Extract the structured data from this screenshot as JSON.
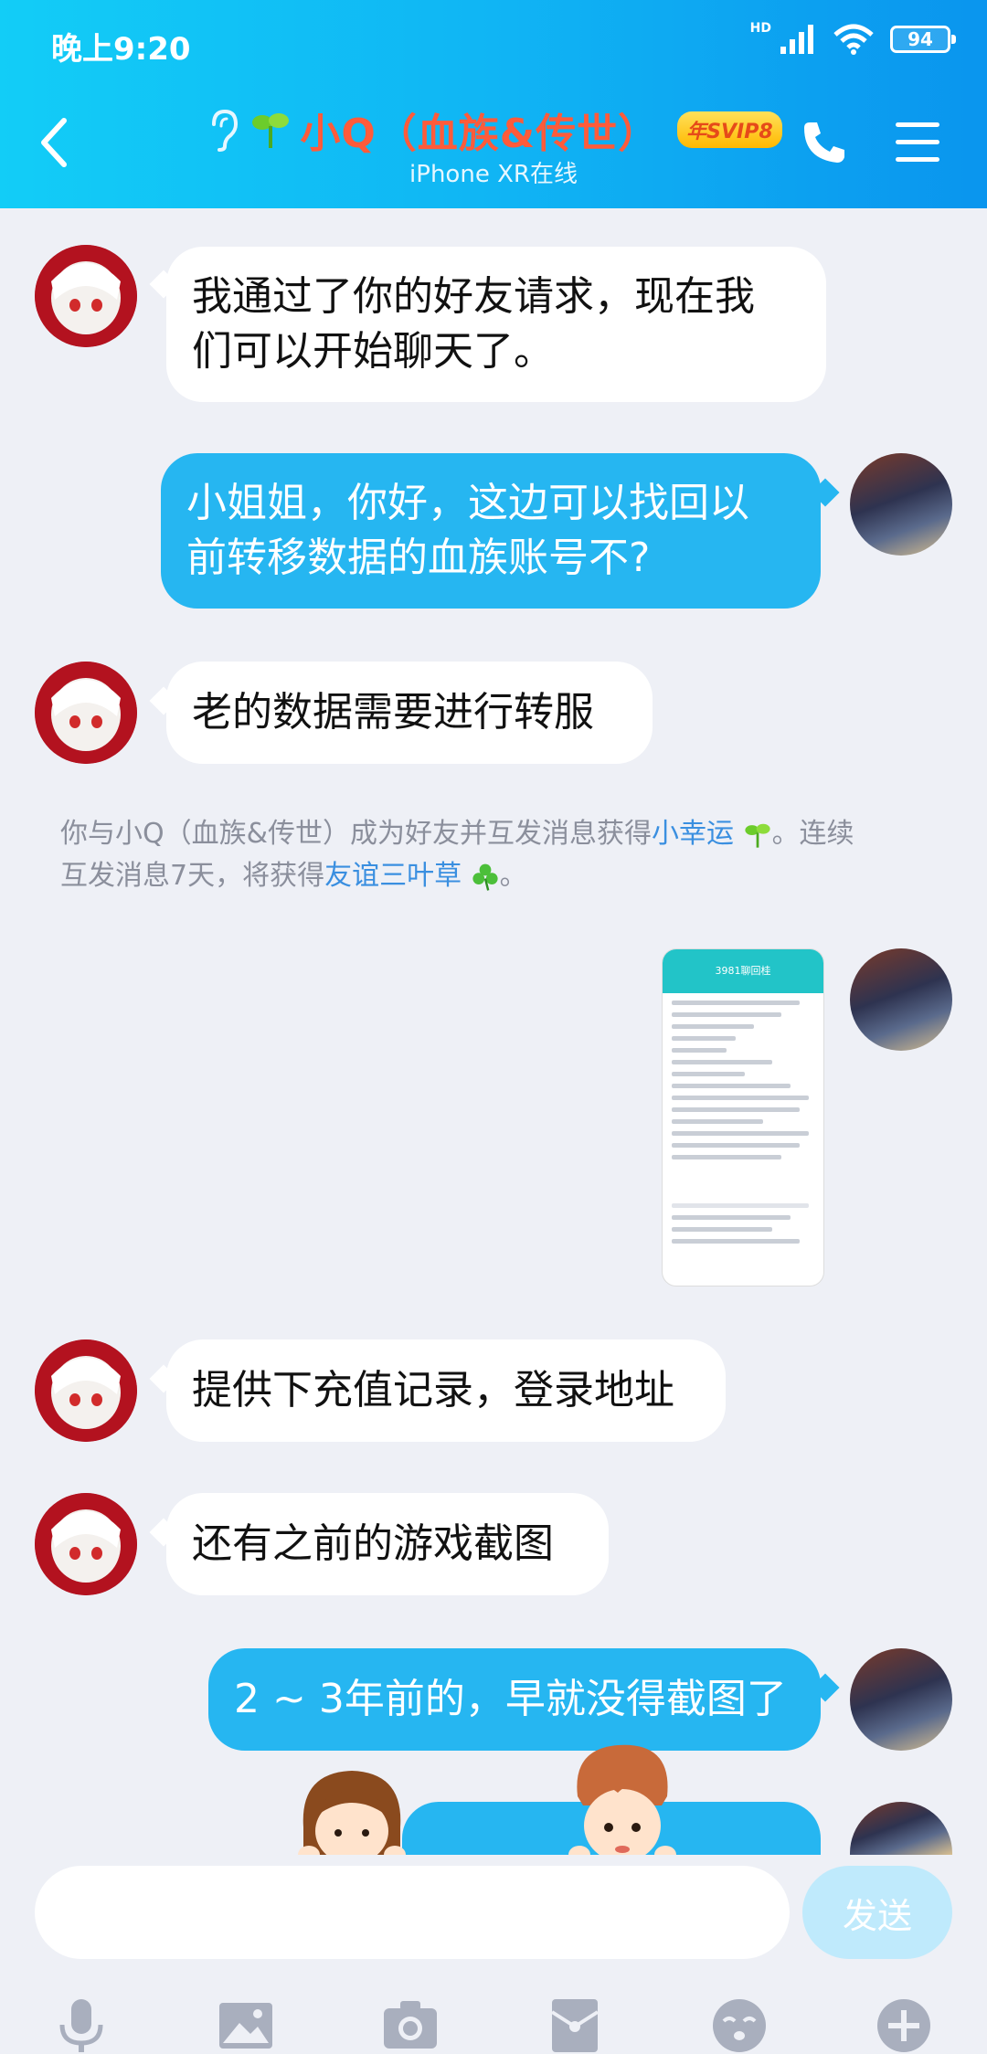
{
  "status_bar": {
    "time": "晚上9:20",
    "hd": "HD",
    "battery": "94"
  },
  "header": {
    "title": "小Q（血族&传世）",
    "badge": "年SVIP8",
    "subtitle": "iPhone XR在线"
  },
  "messages": [
    {
      "side": "left",
      "text_lines": [
        "我通过了你的好友请求，现在我",
        "们可以开始聊天了。"
      ]
    },
    {
      "side": "right",
      "text_lines": [
        "小姐姐，你好，这边可以找回以",
        "前转移数据的血族账号不?"
      ]
    },
    {
      "side": "left",
      "text": "老的数据需要进行转服"
    },
    {
      "side": "left",
      "text": "提供下充值记录，登录地址"
    },
    {
      "side": "left",
      "text": "还有之前的游戏截图"
    },
    {
      "side": "right",
      "text": "2 ~ 3年前的，早就没得截图了"
    }
  ],
  "system_message": {
    "part1": "你与小Q（血族&传世）成为好友并互发消息获得",
    "link1": "小幸运",
    "part2": "。连续",
    "part3": "互发消息7天，将获得",
    "link2": "友谊三叶草",
    "part4": "。"
  },
  "screenshot_message": {
    "title": "3981聊回桂"
  },
  "input": {
    "placeholder": "",
    "send_label": "发送"
  },
  "toolbar": [
    "microphone-icon",
    "image-icon",
    "camera-icon",
    "red-packet-icon",
    "emoji-icon",
    "plus-icon"
  ],
  "colors": {
    "header_start": "#12cdf7",
    "header_end": "#0a95ee",
    "bubble_right": "#26b6f1",
    "bubble_left": "#ffffff",
    "background": "#eef0f6",
    "link": "#3a8fe0"
  }
}
